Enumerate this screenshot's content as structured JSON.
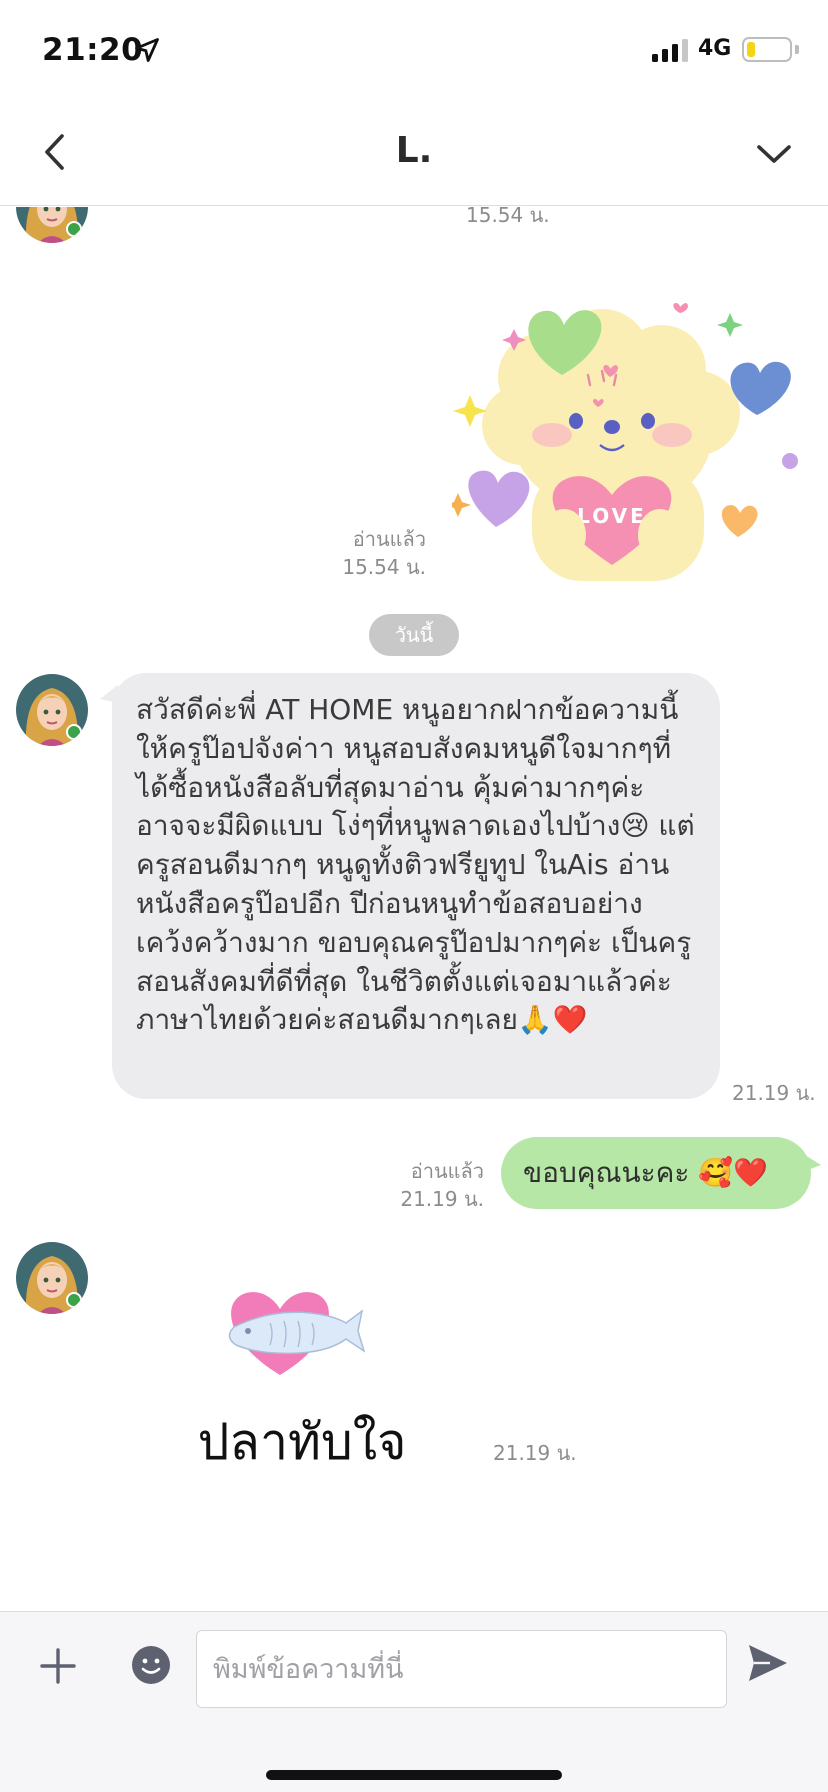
{
  "status": {
    "time": "21:20",
    "network": "4G",
    "battery_level": 0.2,
    "battery_color": "#f5d316"
  },
  "header": {
    "title": "L.",
    "back_icon": "chevron-left-icon",
    "menu_icon": "chevron-down-icon"
  },
  "messages": {
    "top_time": "15.54 น.",
    "sticker_love": {
      "read_label": "อ่านแล้ว",
      "time": "15.54 น.",
      "heart_text": "LOVE"
    },
    "day_label": "วันนี้",
    "incoming_text": {
      "text": "สวัสดีค่ะพี่ AT HOME หนูอยากฝากข้อความนี้ให้ครูป๊อปจังค่าา หนูสอบสังคมหนูดีใจมากๆที่ได้ซื้อหนังสือลับที่สุดมาอ่าน คุ้มค่ามากๆค่ะ อาจจะมีผิดแบบ โง่ๆที่หนูพลาดเองไปบ้าง😢 แต่ครูสอนดีมากๆ หนูดูทั้งติวฟรียูทูป ในAis อ่านหนังสือครูป๊อปอีก ปีก่อนหนูทำข้อสอบอย่างเคว้งคว้างมาก ขอบคุณครูป๊อปมากๆค่ะ เป็นครูสอนสังคมที่ดีที่สุด ในชีวิตตั้งแต่เจอมาแล้วค่ะ ภาษาไทยด้วยค่ะสอนดีมากๆเลย🙏❤️",
      "time": "21.19 น."
    },
    "outgoing_text": {
      "text": "ขอบคุณนะคะ 🥰❤️",
      "read_label": "อ่านแล้ว",
      "time": "21.19 น."
    },
    "sticker_fish": {
      "text": "ปลาทับใจ",
      "time": "21.19 น."
    }
  },
  "input": {
    "placeholder": "พิมพ์ข้อความที่นี่",
    "plus_icon": "plus-icon",
    "emoji_icon": "smiley-icon",
    "send_icon": "send-icon"
  },
  "colors": {
    "incoming_bubble": "#ececef",
    "outgoing_bubble": "#b7e7a6",
    "day_pill": "#c8c8c8"
  }
}
